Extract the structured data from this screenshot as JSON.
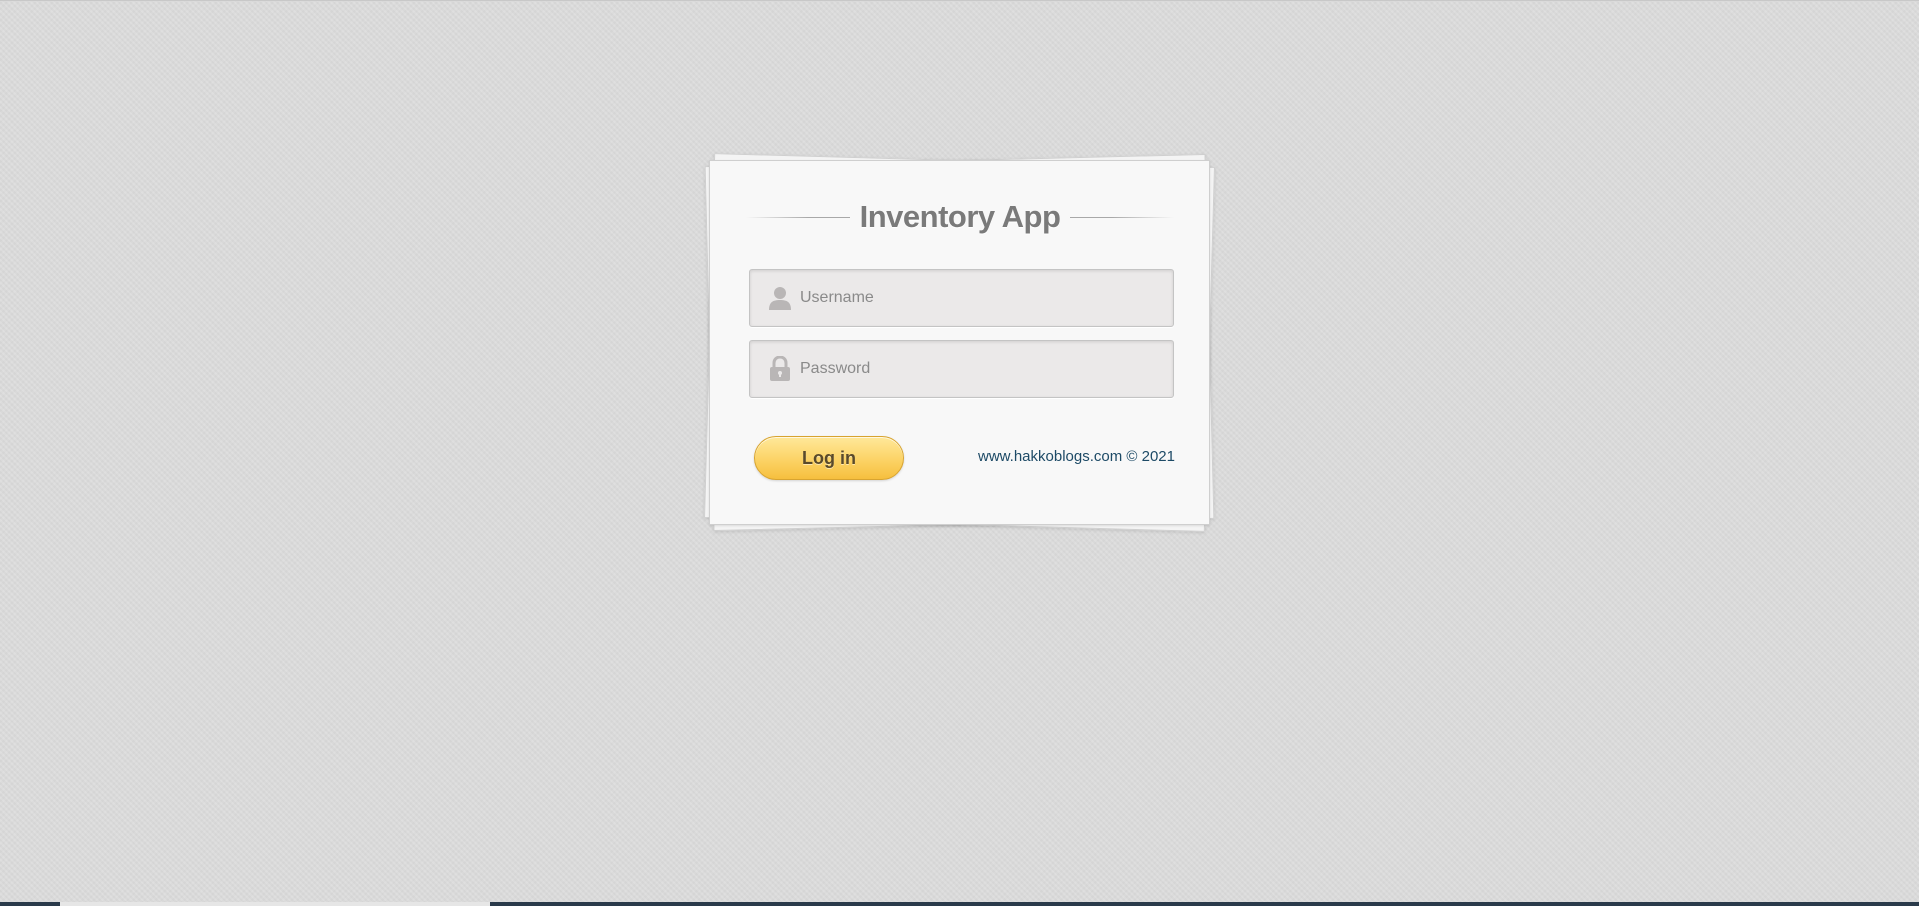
{
  "app": {
    "title": "Inventory App"
  },
  "form": {
    "username": {
      "placeholder": "Username",
      "value": "",
      "icon": "user-icon"
    },
    "password": {
      "placeholder": "Password",
      "value": "",
      "icon": "lock-icon"
    },
    "login_label": "Log in"
  },
  "footer": {
    "link_text": "www.hakkoblogs.com © 2021"
  },
  "colors": {
    "background": "#dcdcdc",
    "card": "#f8f8f8",
    "title": "#7a7a7a",
    "button": "#fcd56a",
    "link": "#1d4a66"
  }
}
